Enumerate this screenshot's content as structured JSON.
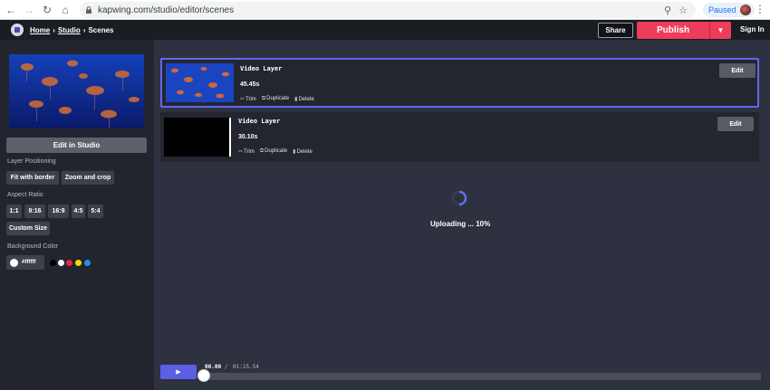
{
  "browser": {
    "url": "kapwing.com/studio/editor/scenes",
    "paused_label": "Paused"
  },
  "header": {
    "breadcrumb": [
      "Home",
      "Studio",
      "Scenes"
    ],
    "breadcrumb_sep": "›",
    "share_label": "Share",
    "publish_label": "Publish",
    "signin_label": "Sign In"
  },
  "sidebar": {
    "edit_studio_label": "Edit in Studio",
    "positioning_label": "Layer Positioning",
    "positioning_options": [
      "Fit with border",
      "Zoom and crop"
    ],
    "aspect_label": "Aspect Ratio",
    "aspect_options": [
      "1:1",
      "9:16",
      "16:9",
      "4:5",
      "5:4"
    ],
    "custom_size_label": "Custom Size",
    "bg_color_label": "Background Color",
    "bg_color_value": "#ffffff",
    "swatches": [
      "#000000",
      "#ffffff",
      "#e8273a",
      "#f5d800",
      "#2b8de8"
    ]
  },
  "layers": [
    {
      "title": "Video Layer",
      "duration": "45.45s",
      "trim": "Trim",
      "duplicate": "Duplicate",
      "delete": "Delete",
      "edit": "Edit",
      "selected": true,
      "thumb": "jellyfish"
    },
    {
      "title": "Video Layer",
      "duration": "30.10s",
      "trim": "Trim",
      "duplicate": "Duplicate",
      "delete": "Delete",
      "edit": "Edit",
      "selected": false,
      "thumb": "black"
    }
  ],
  "upload": {
    "text": "Uploading ... 10%",
    "progress": 0.1
  },
  "timeline": {
    "play_icon": "play-icon",
    "current": "00.00",
    "separator": "/",
    "total": "01:15.54"
  },
  "colors": {
    "accent": "#5b5fe4",
    "publish": "#ee3c5c",
    "bg": "#2e3240",
    "sidebar": "#22252e"
  }
}
